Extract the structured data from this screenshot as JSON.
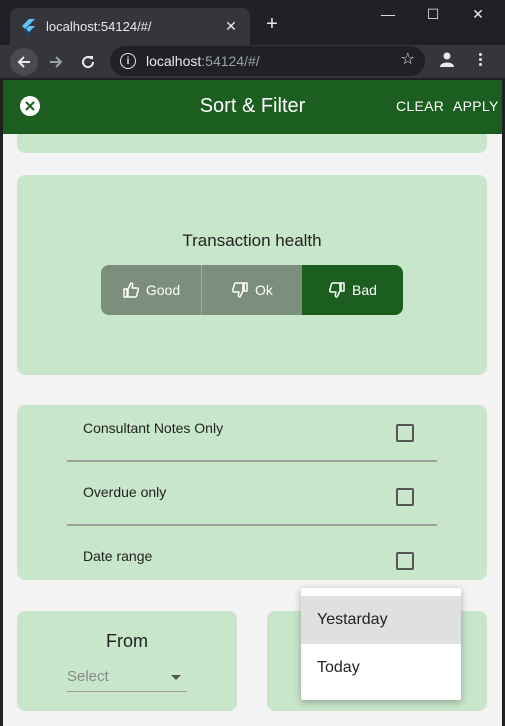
{
  "browser": {
    "tab_title": "localhost:54124/#/",
    "url_host": "localhost",
    "url_rest": ":54124/#/",
    "new_tab": "+",
    "minimize": "—",
    "maximize": "☐",
    "close": "✕"
  },
  "appbar": {
    "title": "Sort & Filter",
    "clear_label": "CLEAR",
    "apply_label": "APPLY"
  },
  "health": {
    "label": "Transaction health",
    "options": [
      {
        "label": "Good",
        "icon": "thumbs-up-icon",
        "selected": false
      },
      {
        "label": "Ok",
        "icon": "thumbs-down-icon",
        "selected": false
      },
      {
        "label": "Bad",
        "icon": "thumbs-down-icon",
        "selected": true
      }
    ]
  },
  "filters": [
    {
      "label": "Consultant Notes Only",
      "checked": false
    },
    {
      "label": "Overdue only",
      "checked": false
    },
    {
      "label": "Date range",
      "checked": false
    }
  ],
  "from": {
    "label": "From",
    "placeholder": "Select"
  },
  "dropdown": {
    "items": [
      {
        "label": "Yestarday",
        "highlighted": true
      },
      {
        "label": "Today",
        "highlighted": false
      }
    ]
  },
  "colors": {
    "primary": "#1b5e1f",
    "card": "#c8e6c9",
    "segment_unselected": "#7c8f7c",
    "background": "#f3f3f3"
  }
}
